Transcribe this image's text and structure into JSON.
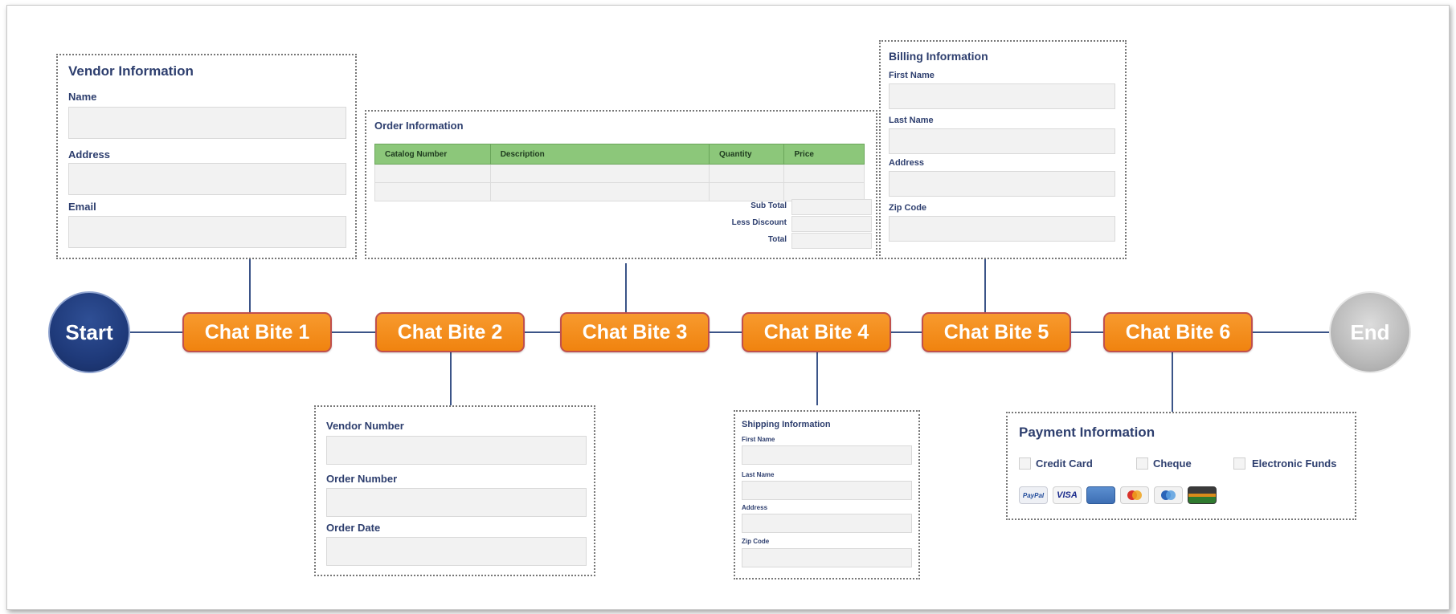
{
  "timeline": {
    "start": "Start",
    "end": "End",
    "bites": [
      "Chat Bite 1",
      "Chat Bite 2",
      "Chat Bite 3",
      "Chat Bite 4",
      "Chat Bite 5",
      "Chat Bite 6"
    ]
  },
  "vendor_info": {
    "title": "Vendor Information",
    "fields": [
      "Name",
      "Address",
      "Email"
    ]
  },
  "order_ids": {
    "fields": [
      "Vendor Number",
      "Order Number",
      "Order Date"
    ]
  },
  "order_info": {
    "title": "Order Information",
    "columns": [
      "Catalog Number",
      "Description",
      "Quantity",
      "Price"
    ],
    "summary": [
      "Sub Total",
      "Less Discount",
      "Total"
    ]
  },
  "shipping_info": {
    "title": "Shipping Information",
    "fields": [
      "First Name",
      "Last Name",
      "Address",
      "Zip Code"
    ]
  },
  "billing_info": {
    "title": "Billing Information",
    "fields": [
      "First Name",
      "Last Name",
      "Address",
      "Zip Code"
    ]
  },
  "payment_info": {
    "title": "Payment Information",
    "options": [
      "Credit Card",
      "Cheque",
      "Electronic Funds"
    ],
    "cards": [
      {
        "label": "PayPal",
        "icon": "paypal-icon"
      },
      {
        "label": "VISA",
        "icon": "visa-icon"
      },
      {
        "label": "",
        "icon": "amex-icon"
      },
      {
        "label": "",
        "icon": "mastercard-icon"
      },
      {
        "label": "",
        "icon": "cirrus-icon"
      },
      {
        "label": "",
        "icon": "discover-icon"
      }
    ]
  },
  "colors": {
    "bite_fill": "#f38d1d",
    "start_fill": "#1f3a7a",
    "end_fill": "#bdbdbd",
    "connector": "#3b5488",
    "table_header": "#8cc77a"
  }
}
